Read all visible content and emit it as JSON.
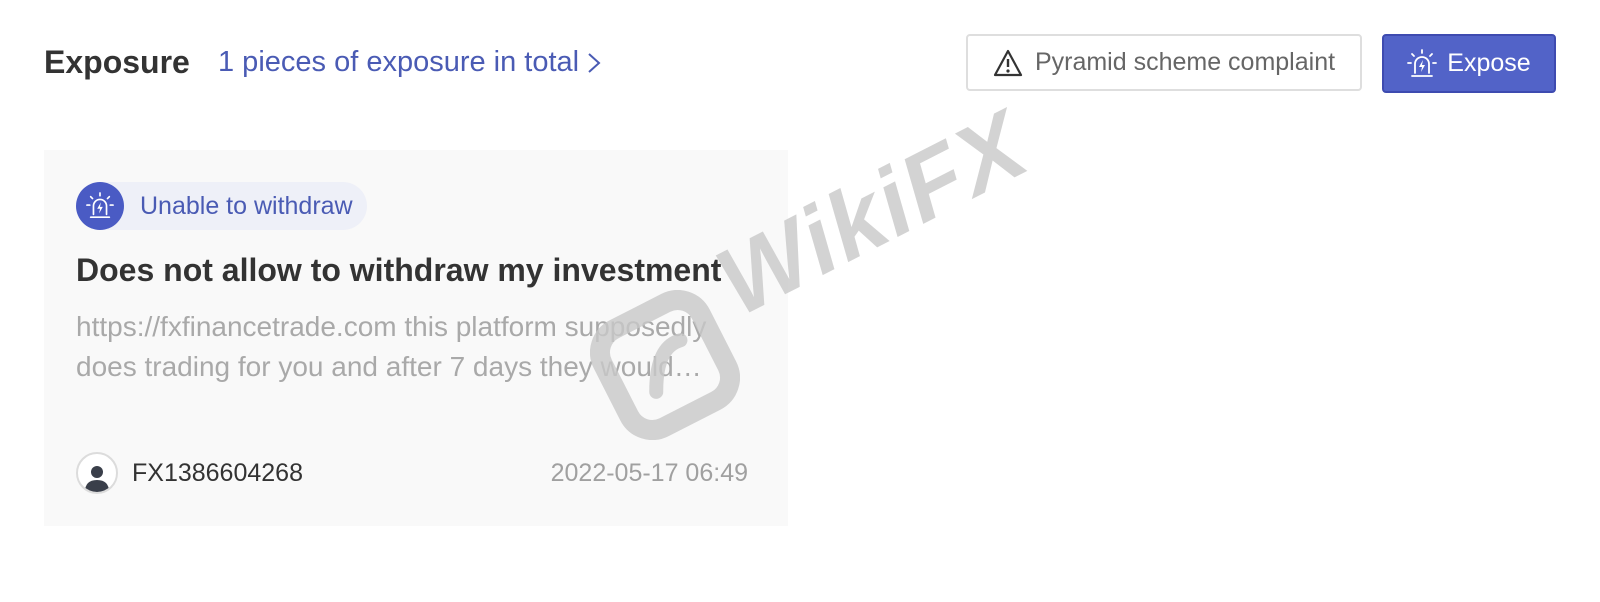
{
  "header": {
    "title": "Exposure",
    "total_link": "1 pieces of exposure in total",
    "complaint_button": "Pyramid scheme complaint",
    "expose_button": "Expose"
  },
  "exposures": [
    {
      "tag": "Unable to withdraw",
      "title": "Does not allow to withdraw my investment",
      "excerpt": "https://fxfinancetrade.com this platform supposedly does trading for you and after 7 days they would…",
      "author": "FX1386604268",
      "timestamp": "2022-05-17 06:49"
    }
  ],
  "watermark": "WikiFX",
  "colors": {
    "accent": "#5263c8",
    "link": "#4a5bb4",
    "card_bg": "#f9f9f9"
  }
}
